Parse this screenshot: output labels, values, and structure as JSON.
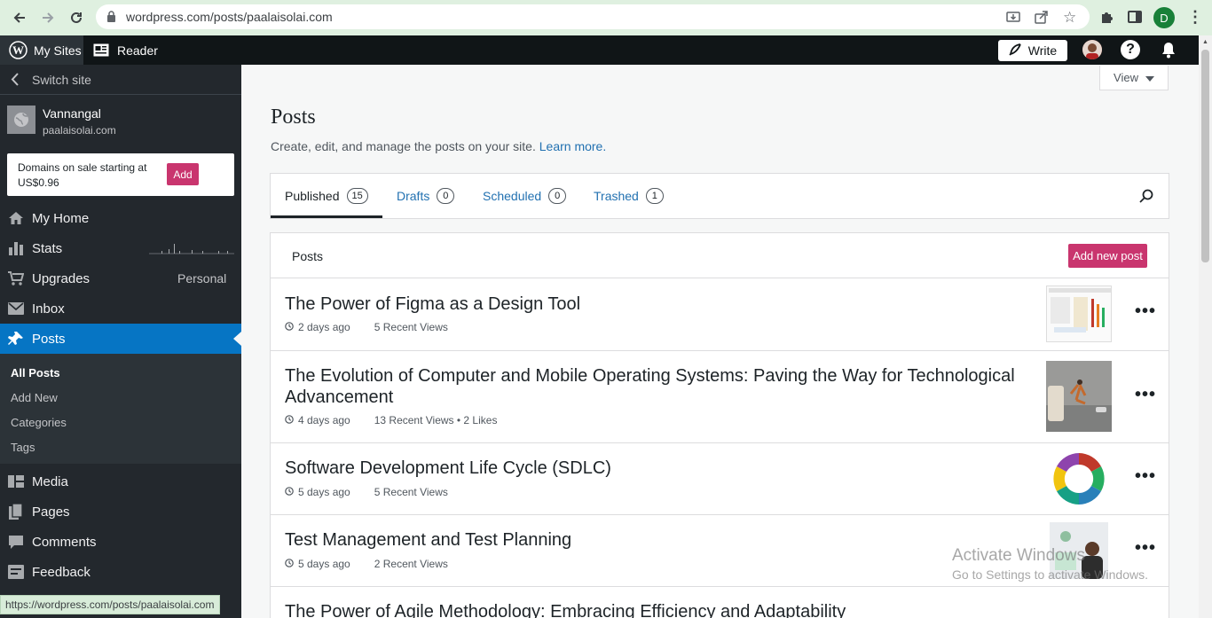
{
  "browser": {
    "url": "wordpress.com/posts/paalaisolai.com",
    "status_url": "https://wordpress.com/posts/paalaisolai.com",
    "profile_initial": "D"
  },
  "masterbar": {
    "my_sites": "My Sites",
    "reader": "Reader",
    "write": "Write"
  },
  "sidebar": {
    "switch_site": "Switch site",
    "site_name": "Vannangal",
    "site_domain": "paalaisolai.com",
    "promo_text": "Domains on sale starting at US$0.96",
    "promo_button": "Add",
    "items": [
      {
        "label": "My Home"
      },
      {
        "label": "Stats"
      },
      {
        "label": "Upgrades",
        "badge": "Personal"
      },
      {
        "label": "Inbox"
      },
      {
        "label": "Posts"
      },
      {
        "label": "Media"
      },
      {
        "label": "Pages"
      },
      {
        "label": "Comments"
      },
      {
        "label": "Feedback"
      }
    ],
    "sub_items": [
      "All Posts",
      "Add New",
      "Categories",
      "Tags"
    ]
  },
  "main": {
    "view_button": "View",
    "title": "Posts",
    "subtitle": "Create, edit, and manage the posts on your site.",
    "learn_more": "Learn more.",
    "tabs": [
      {
        "label": "Published",
        "count": "15"
      },
      {
        "label": "Drafts",
        "count": "0"
      },
      {
        "label": "Scheduled",
        "count": "0"
      },
      {
        "label": "Trashed",
        "count": "1"
      }
    ],
    "list_header": "Posts",
    "add_new_post": "Add new post",
    "posts": [
      {
        "title": "The Power of Figma as a Design Tool",
        "time": "2 days ago",
        "stats": "5 Recent Views"
      },
      {
        "title": "The Evolution of Computer and Mobile Operating Systems: Paving the Way for Technological Advancement",
        "time": "4 days ago",
        "stats": "13 Recent Views • 2 Likes"
      },
      {
        "title": "Software Development Life Cycle (SDLC)",
        "time": "5 days ago",
        "stats": "5 Recent Views"
      },
      {
        "title": "Test Management and Test Planning",
        "time": "5 days ago",
        "stats": "2 Recent Views"
      },
      {
        "title": "The Power of Agile Methodology: Embracing Efficiency and Adaptability",
        "time": "",
        "stats": ""
      }
    ]
  },
  "watermark": {
    "line1": "Activate Windows",
    "line2": "Go to Settings to activate Windows."
  },
  "colors": {
    "accent": "#c9356e",
    "sidebar_bg": "#23282d",
    "selected": "#0675c4",
    "link": "#2271b1"
  }
}
